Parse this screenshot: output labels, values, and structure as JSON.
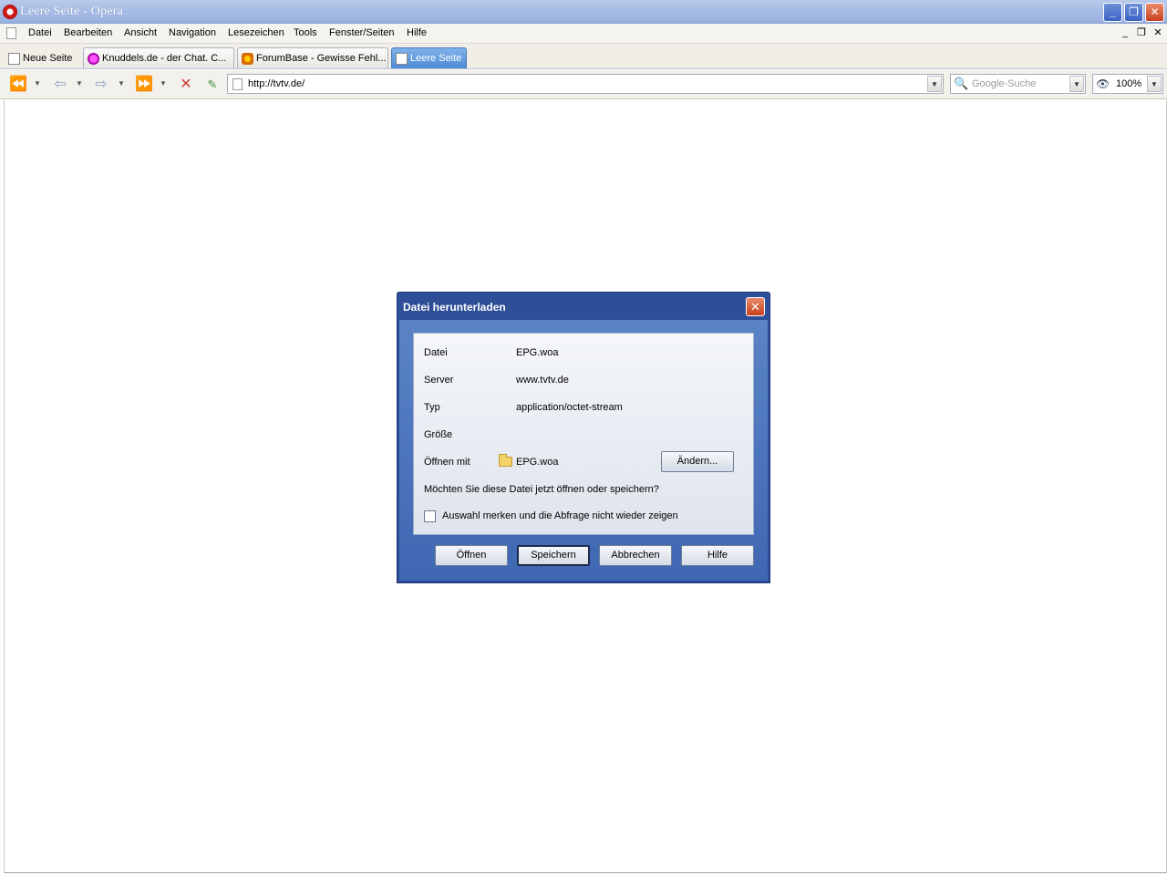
{
  "window": {
    "title": "Leere Seite - Opera"
  },
  "menu": [
    "Datei",
    "Bearbeiten",
    "Ansicht",
    "Navigation",
    "Lesezeichen",
    "Tools",
    "Fenster/Seiten",
    "Hilfe"
  ],
  "tabs": [
    {
      "label": "Neue Seite"
    },
    {
      "label": "Knuddels.de - der Chat. C..."
    },
    {
      "label": "ForumBase - Gewisse Fehl..."
    },
    {
      "label": "Leere Seite"
    }
  ],
  "address": {
    "url": "http://tvtv.de/"
  },
  "search": {
    "placeholder": "Google-Suche"
  },
  "zoom": {
    "value": "100%"
  },
  "dialog": {
    "title": "Datei herunterladen",
    "rows": [
      {
        "label": "Datei",
        "value": "EPG.woa"
      },
      {
        "label": "Server",
        "value": "www.tvtv.de"
      },
      {
        "label": "Typ",
        "value": "application/octet-stream"
      },
      {
        "label": "Größe",
        "value": ""
      },
      {
        "label": "Öffnen mit",
        "value": "EPG.woa"
      }
    ],
    "change_button": "Ändern...",
    "question": "Möchten Sie diese Datei jetzt öffnen oder speichern?",
    "remember_label": "Auswahl merken und die Abfrage nicht wieder zeigen",
    "buttons": {
      "open": "Öffnen",
      "save": "Speichern",
      "cancel": "Abbrechen",
      "help": "Hilfe"
    }
  }
}
